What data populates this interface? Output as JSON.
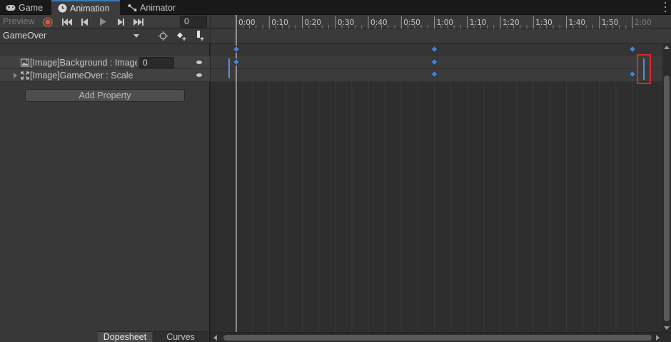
{
  "tabs": [
    {
      "label": "Game",
      "icon": "gamepad-icon"
    },
    {
      "label": "Animation",
      "icon": "clock-icon"
    },
    {
      "label": "Animator",
      "icon": "animator-icon"
    }
  ],
  "controls": {
    "preview_label": "Preview",
    "frame_value": "0"
  },
  "clip": {
    "selected": "GameOver"
  },
  "properties": [
    {
      "label": "[Image]Background : Image",
      "value": "0",
      "icon": "image-icon"
    },
    {
      "label": "[Image]GameOver : Scale",
      "icon": "scale-icon"
    }
  ],
  "add_property_label": "Add Property",
  "view_tabs": {
    "dopesheet": "Dopesheet",
    "curves": "Curves"
  },
  "timeline": {
    "tick_labels": [
      "0:00",
      "0:10",
      "0:20",
      "0:30",
      "0:40",
      "0:50",
      "1:00",
      "1:10",
      "1:20",
      "1:30",
      "1:40",
      "1:50",
      "2:00"
    ],
    "keyframe_times": {
      "summary": [
        "0:00",
        "1:00",
        "2:00"
      ],
      "background_image": [
        "0:00",
        "1:00"
      ],
      "gameover_scale": [
        "1:00",
        "2:00"
      ]
    }
  },
  "colors": {
    "accent": "#3a79bb",
    "keyframe": "#4f7fc4",
    "highlight": "#e0262d",
    "record": "#d05a44"
  }
}
